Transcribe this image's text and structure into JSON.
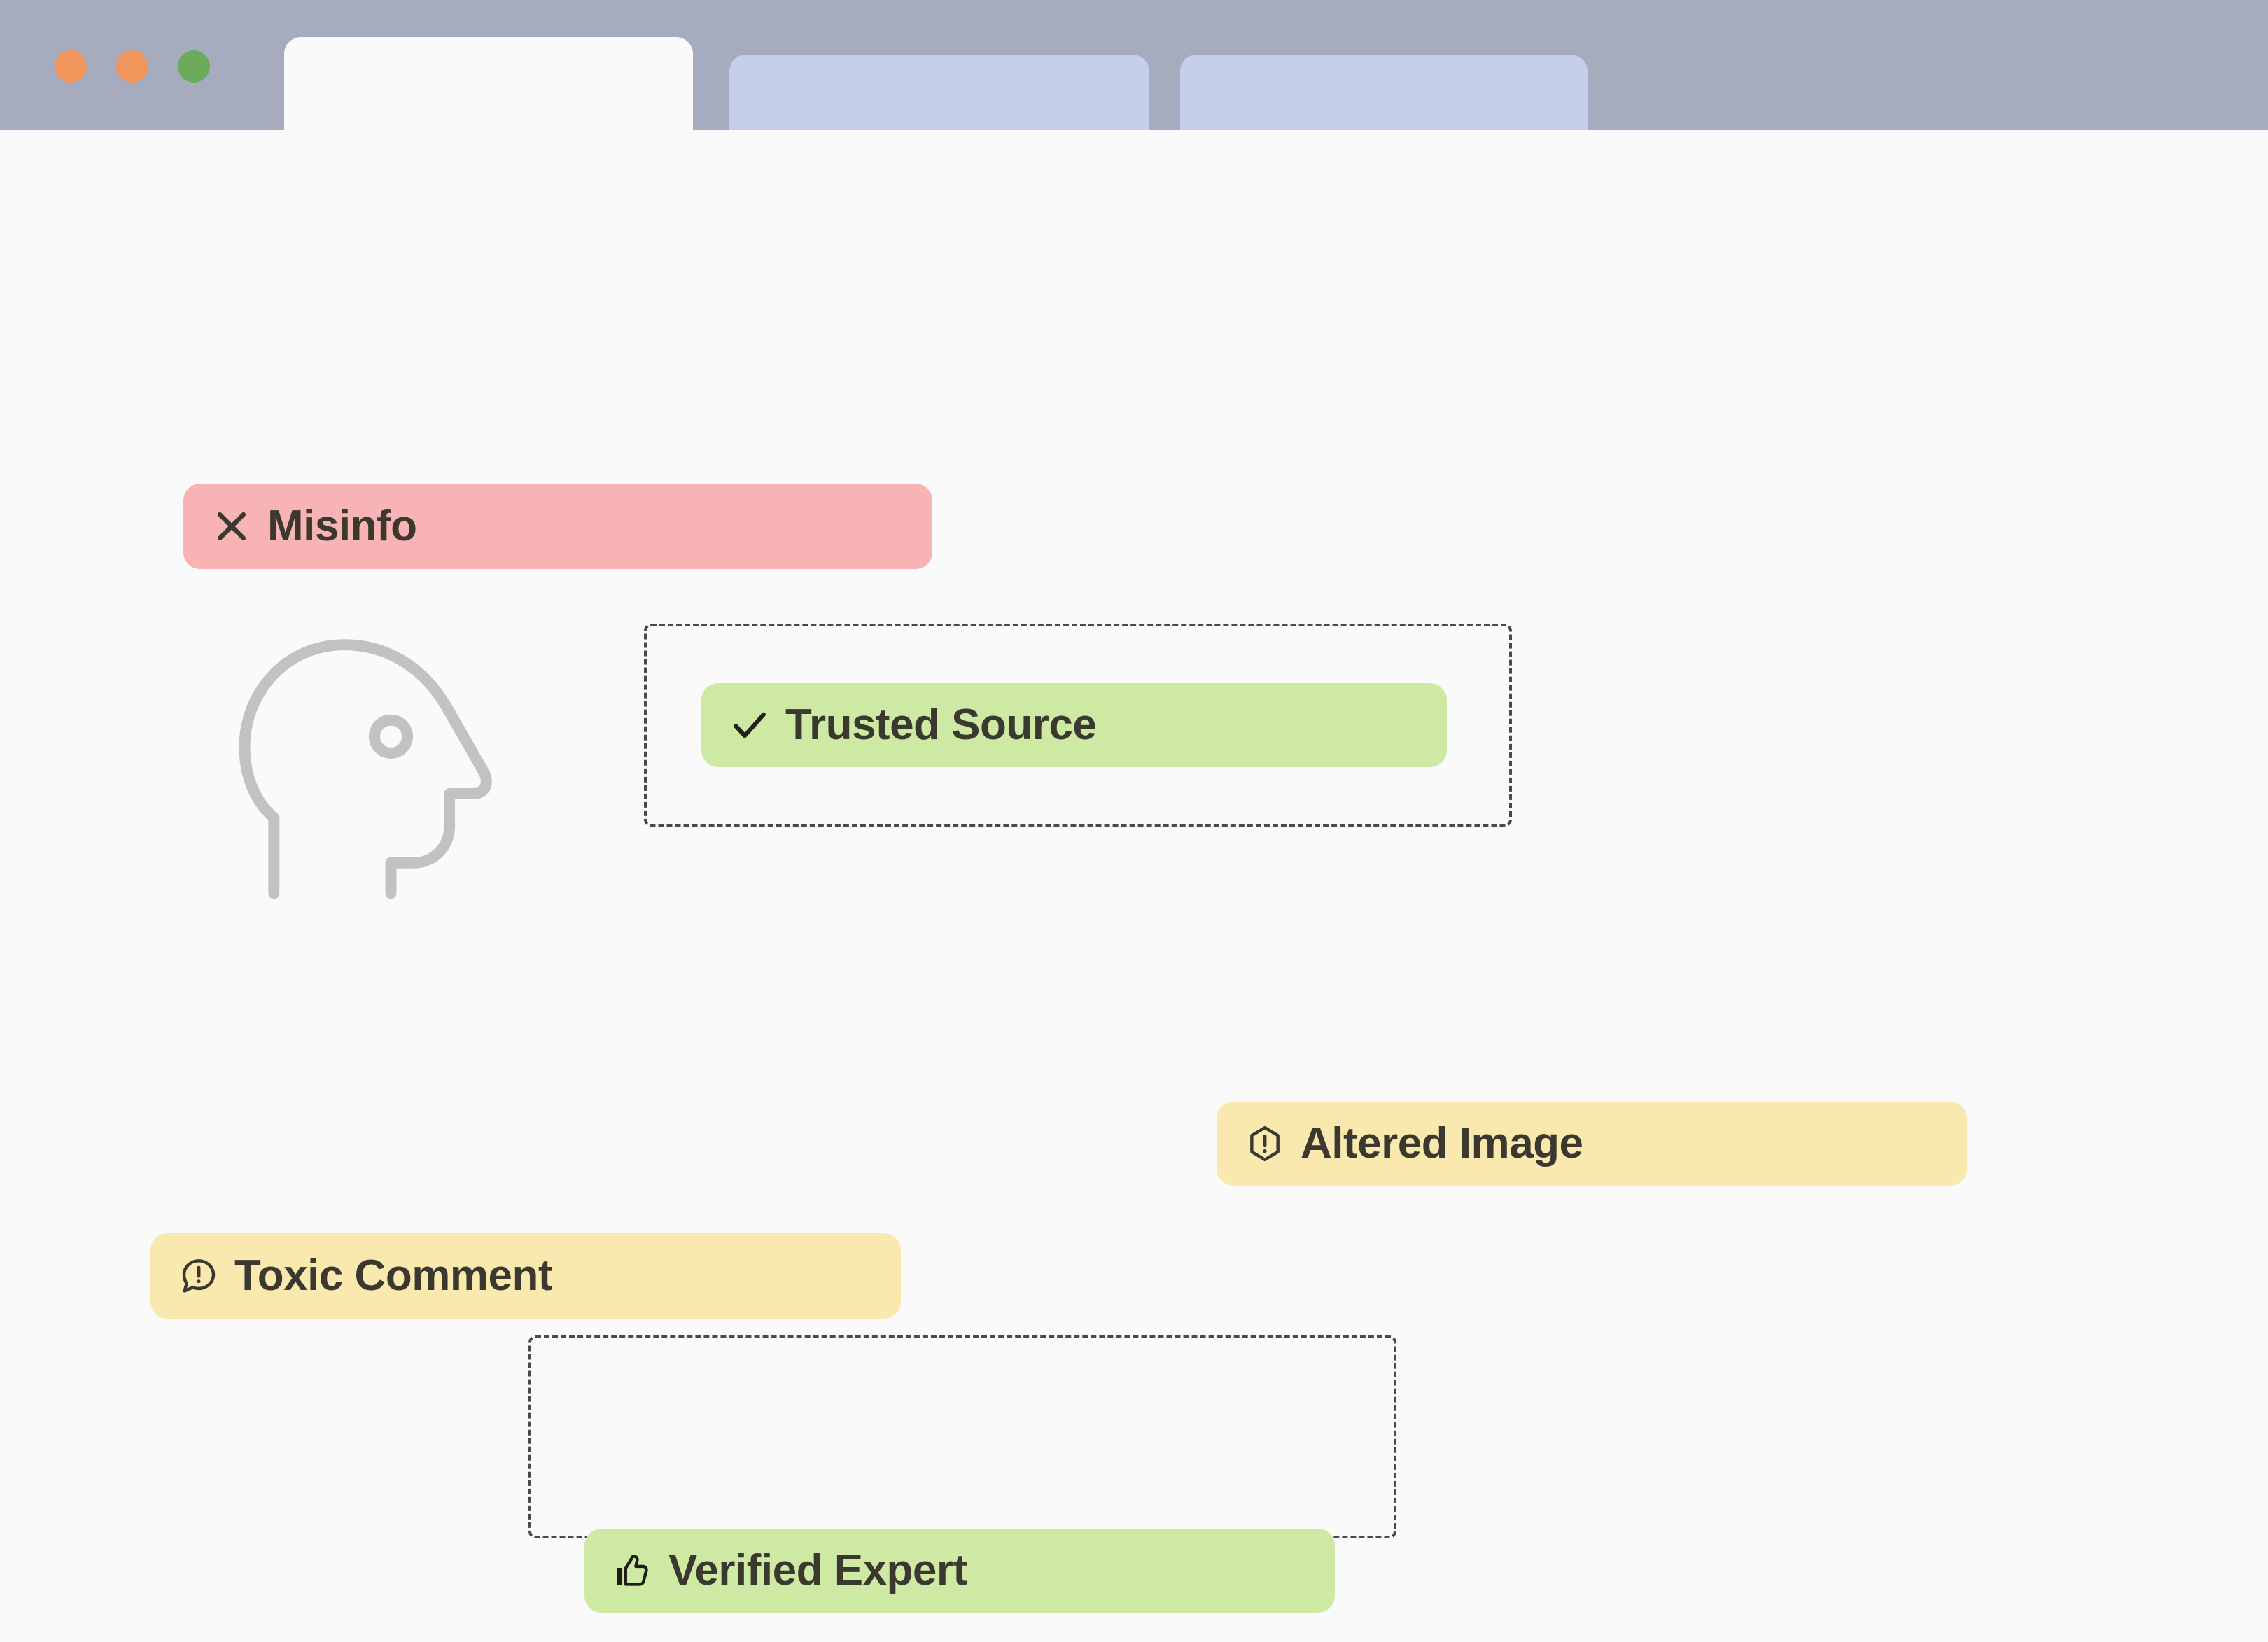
{
  "window": {
    "chrome_color": "#a6acbd",
    "page_background": "#fbfafb",
    "traffic_lights": [
      {
        "name": "close",
        "color": "#f0955c"
      },
      {
        "name": "minimize",
        "color": "#f0955c"
      },
      {
        "name": "maximize",
        "color": "#6cab5b"
      }
    ],
    "tabs": [
      {
        "label": "",
        "active": true,
        "color": "#fbfafb"
      },
      {
        "label": "",
        "active": false,
        "color": "#c5cfea"
      },
      {
        "label": "",
        "active": false,
        "color": "#c5cfea"
      }
    ]
  },
  "canvas": {
    "illustration": {
      "name": "head-profile-outline",
      "stroke_color": "#c2c2c2"
    },
    "dropzones": [
      {
        "name": "trusted-source-dropzone",
        "border_color": "#4c4a40",
        "contains": "Trusted Source"
      },
      {
        "name": "verified-expert-dropzone",
        "border_color": "#4c4a40",
        "contains": "Verified Expert"
      }
    ],
    "badges": [
      {
        "id": "misinfo",
        "label": "Misinfo",
        "icon": "x-icon",
        "background": "#f8b4b4",
        "text_color": "#3b392f",
        "in_dropzone": false
      },
      {
        "id": "trusted_source",
        "label": "Trusted Source",
        "icon": "check-icon",
        "background": "#cde9a4",
        "text_color": "#3b392f",
        "in_dropzone": true
      },
      {
        "id": "altered_image",
        "label": "Altered Image",
        "icon": "warning-hexagon-icon",
        "background": "#f9e9ae",
        "text_color": "#3b392f",
        "in_dropzone": false
      },
      {
        "id": "toxic_comment",
        "label": "Toxic Comment",
        "icon": "comment-alert-icon",
        "background": "#f9e9ae",
        "text_color": "#3b392f",
        "in_dropzone": false
      },
      {
        "id": "verified_expert",
        "label": "Verified Expert",
        "icon": "thumbs-up-icon",
        "background": "#cde9a4",
        "text_color": "#3b392f",
        "in_dropzone": true
      }
    ]
  }
}
